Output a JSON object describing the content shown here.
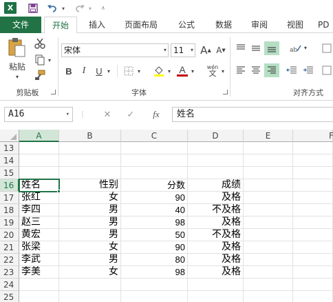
{
  "colors": {
    "brand": "#217346",
    "accent_blue": "#3a6ea5",
    "font_red": "#c00000",
    "highlight_yellow": "#ffff00"
  },
  "qat": {
    "icons": [
      "excel-icon",
      "save-icon",
      "undo-icon",
      "redo-icon",
      "customize-icon"
    ],
    "excel_letter": "X"
  },
  "tabs": [
    "文件",
    "开始",
    "插入",
    "页面布局",
    "公式",
    "数据",
    "审阅",
    "视图",
    "PD"
  ],
  "ribbon": {
    "clipboard": {
      "paste_label": "粘贴",
      "group_label": "剪贴板"
    },
    "font": {
      "font_name": "宋体",
      "font_size": "11",
      "bold": "B",
      "italic": "I",
      "underline": "U",
      "grow": "A",
      "shrink": "A",
      "pinyin": "wén",
      "font_color_letter": "A",
      "group_label": "字体"
    },
    "alignment": {
      "group_label": "对齐方式"
    }
  },
  "formula_bar": {
    "name_box": "A16",
    "cancel": "✕",
    "enter": "✓",
    "fx": "fx",
    "content": "姓名"
  },
  "sheet": {
    "columns": [
      "A",
      "B",
      "C",
      "D",
      "E",
      "F"
    ],
    "active_column": "A",
    "active_row": "16",
    "rows": [
      {
        "num": "13",
        "cells": [
          "",
          "",
          "",
          ""
        ]
      },
      {
        "num": "14",
        "cells": [
          "",
          "",
          "",
          ""
        ]
      },
      {
        "num": "15",
        "cells": [
          "",
          "",
          "",
          ""
        ]
      },
      {
        "num": "16",
        "cells": [
          "姓名",
          "性别",
          "分数",
          "成绩"
        ]
      },
      {
        "num": "17",
        "cells": [
          "张红",
          "女",
          "90",
          "及格"
        ]
      },
      {
        "num": "18",
        "cells": [
          "李四",
          "男",
          "40",
          "不及格"
        ]
      },
      {
        "num": "19",
        "cells": [
          "赵三",
          "男",
          "98",
          "及格"
        ]
      },
      {
        "num": "20",
        "cells": [
          "黄宏",
          "男",
          "50",
          "不及格"
        ]
      },
      {
        "num": "21",
        "cells": [
          "张梁",
          "女",
          "90",
          "及格"
        ]
      },
      {
        "num": "22",
        "cells": [
          "李武",
          "男",
          "80",
          "及格"
        ]
      },
      {
        "num": "23",
        "cells": [
          "李美",
          "女",
          "98",
          "及格"
        ]
      },
      {
        "num": "24",
        "cells": [
          "",
          "",
          "",
          ""
        ]
      },
      {
        "num": "25",
        "cells": [
          "",
          "",
          "",
          ""
        ]
      }
    ]
  }
}
